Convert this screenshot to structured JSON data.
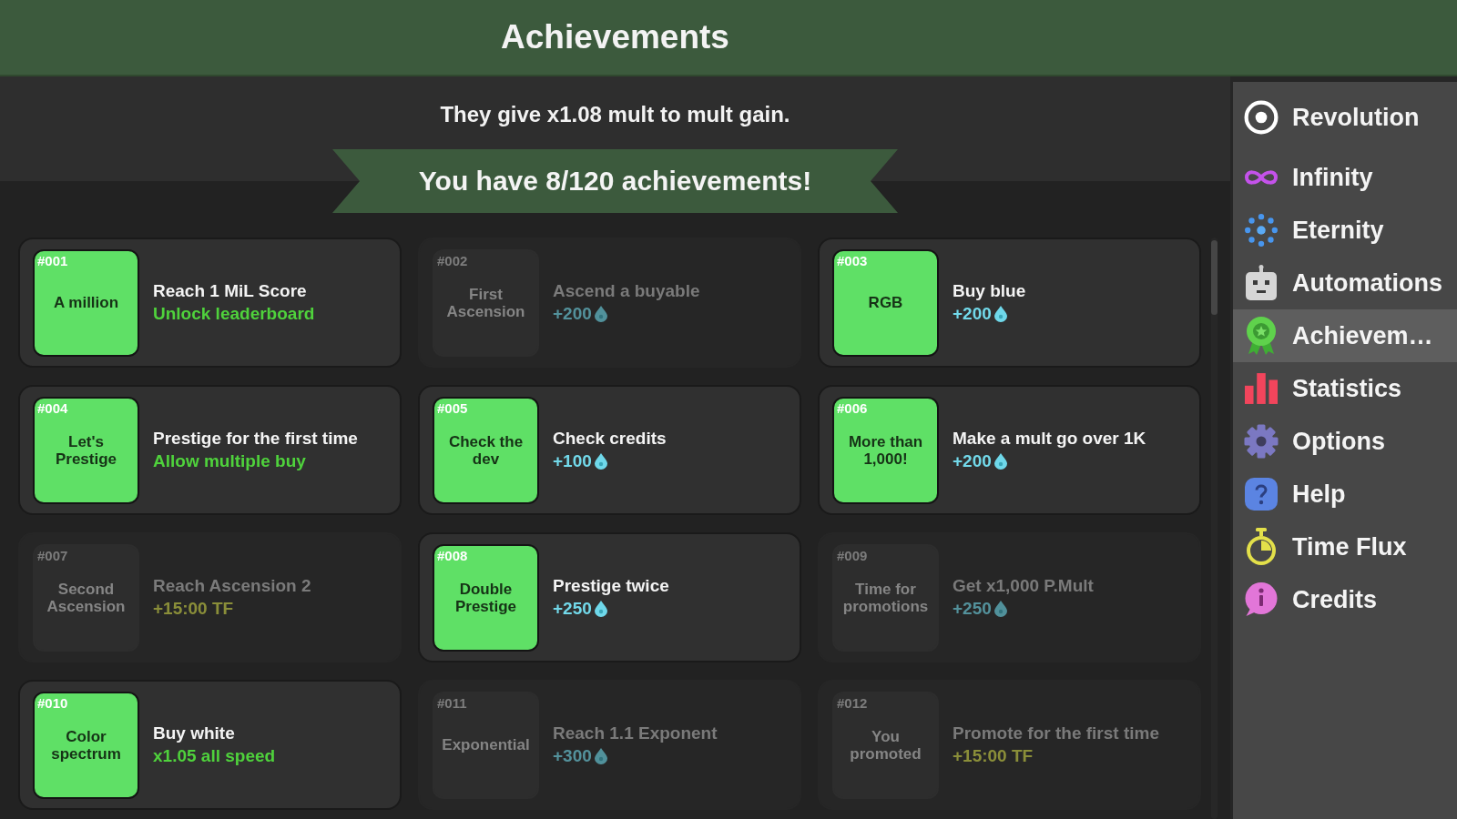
{
  "header": {
    "title": "Achievements"
  },
  "summary": {
    "bonus_text": "They give x1.08 mult to mult gain.",
    "count_banner": "You have 8/120 achievements!"
  },
  "achievements": [
    {
      "number": "#001",
      "name": "A million",
      "requirement": "Reach 1 MiL Score",
      "reward": {
        "kind": "bonus",
        "text": "Unlock leaderboard"
      },
      "unlocked": true
    },
    {
      "number": "#002",
      "name": "First Ascension",
      "requirement": "Ascend a buyable",
      "reward": {
        "kind": "points",
        "text": "+200"
      },
      "unlocked": false
    },
    {
      "number": "#003",
      "name": "RGB",
      "requirement": "Buy blue",
      "reward": {
        "kind": "points",
        "text": "+200"
      },
      "unlocked": true
    },
    {
      "number": "#004",
      "name": "Let's Prestige",
      "requirement": "Prestige for the first time",
      "reward": {
        "kind": "bonus",
        "text": "Allow multiple buy"
      },
      "unlocked": true
    },
    {
      "number": "#005",
      "name": "Check the dev",
      "requirement": "Check credits",
      "reward": {
        "kind": "points",
        "text": "+100"
      },
      "unlocked": true
    },
    {
      "number": "#006",
      "name": "More than 1,000!",
      "requirement": "Make a mult go over 1K",
      "reward": {
        "kind": "points",
        "text": "+200"
      },
      "unlocked": true
    },
    {
      "number": "#007",
      "name": "Second Ascension",
      "requirement": "Reach Ascension 2",
      "reward": {
        "kind": "time",
        "text": "+15:00 TF"
      },
      "unlocked": false
    },
    {
      "number": "#008",
      "name": "Double Prestige",
      "requirement": "Prestige twice",
      "reward": {
        "kind": "points",
        "text": "+250"
      },
      "unlocked": true
    },
    {
      "number": "#009",
      "name": "Time for promotions",
      "requirement": "Get x1,000 P.Mult",
      "reward": {
        "kind": "points",
        "text": "+250"
      },
      "unlocked": false
    },
    {
      "number": "#010",
      "name": "Color spectrum",
      "requirement": "Buy white",
      "reward": {
        "kind": "bonus",
        "text": "x1.05 all speed"
      },
      "unlocked": true
    },
    {
      "number": "#011",
      "name": "Exponential",
      "requirement": "Reach 1.1 Exponent",
      "reward": {
        "kind": "points",
        "text": "+300"
      },
      "unlocked": false
    },
    {
      "number": "#012",
      "name": "You promoted",
      "requirement": "Promote for the first time",
      "reward": {
        "kind": "time",
        "text": "+15:00 TF"
      },
      "unlocked": false
    }
  ],
  "sidebar": {
    "items": [
      {
        "label": "Revolution",
        "selected": false
      },
      {
        "label": "Infinity",
        "selected": false
      },
      {
        "label": "Eternity",
        "selected": false
      },
      {
        "label": "Automations",
        "selected": false
      },
      {
        "label": "Achievem…",
        "selected": true
      },
      {
        "label": "Statistics",
        "selected": false
      },
      {
        "label": "Options",
        "selected": false
      },
      {
        "label": "Help",
        "selected": false
      },
      {
        "label": "Time Flux",
        "selected": false
      },
      {
        "label": "Credits",
        "selected": false
      }
    ]
  }
}
